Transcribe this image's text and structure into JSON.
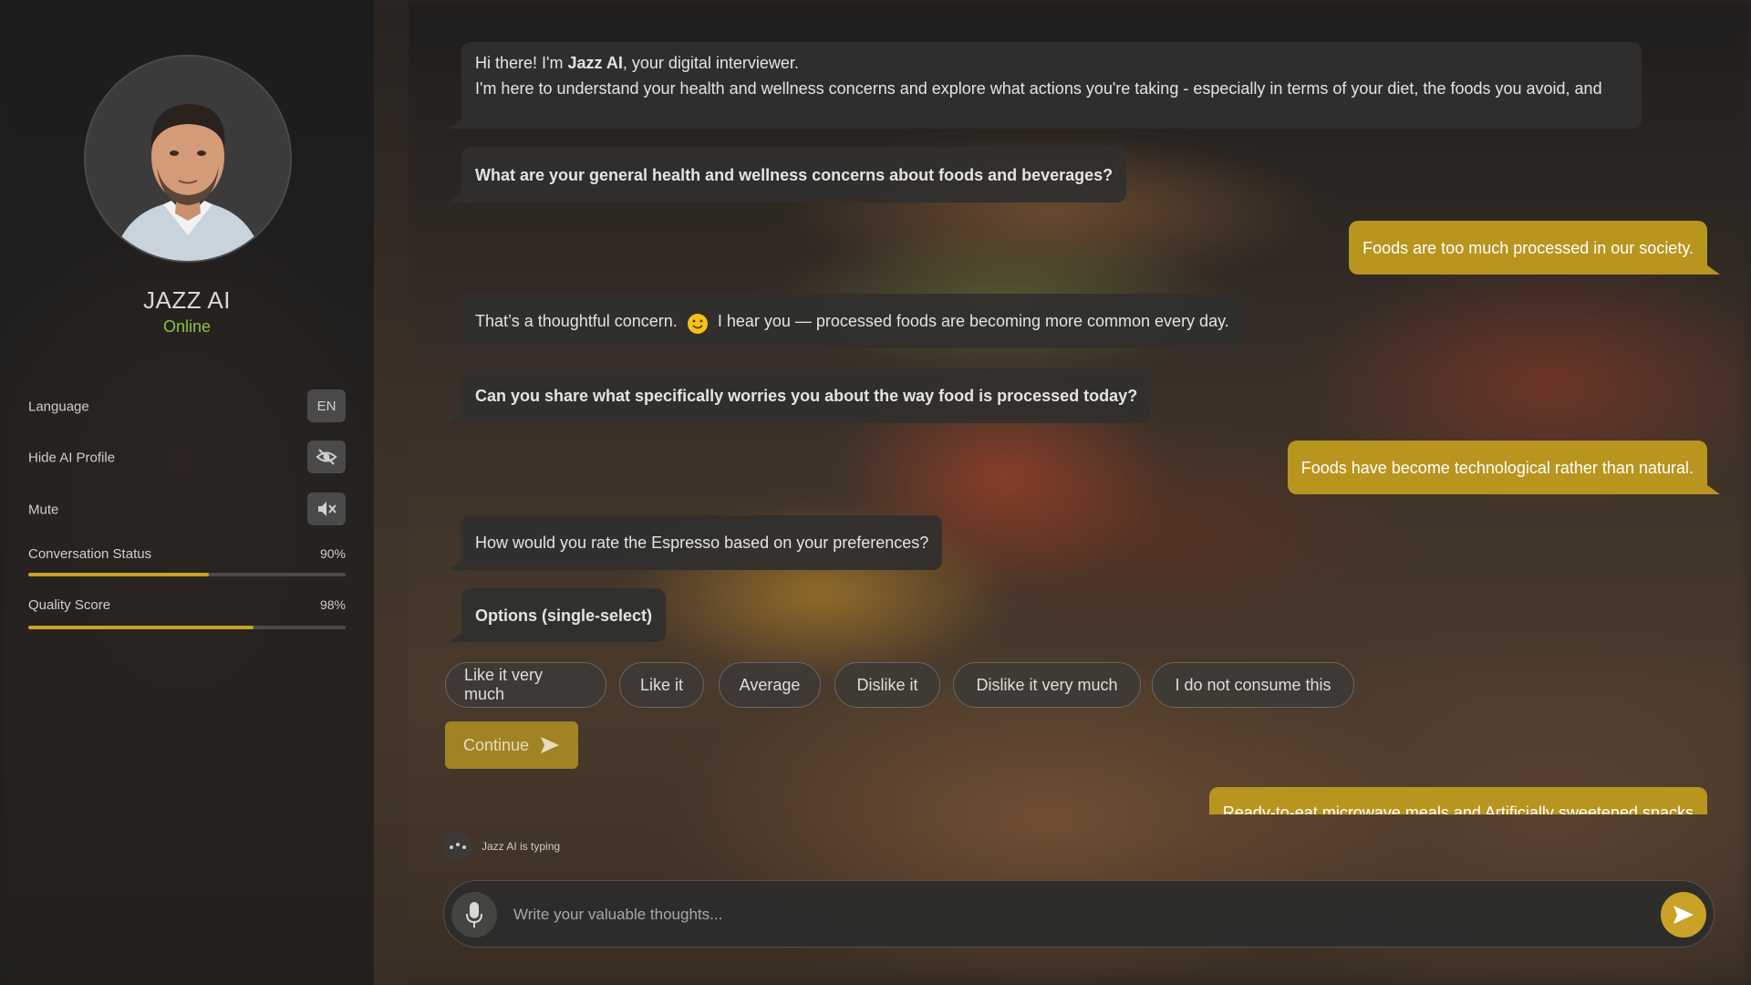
{
  "agent": {
    "name": "JAZZ AI",
    "status": "Online"
  },
  "settings": {
    "language_label": "Language",
    "language_value": "EN",
    "hide_profile_label": "Hide AI Profile",
    "mute_label": "Mute"
  },
  "progress": {
    "conversation_label": "Conversation Status",
    "conversation_value": "90%",
    "conversation_fill": 0.57,
    "quality_label": "Quality Score",
    "quality_value": "98%",
    "quality_fill": 0.71
  },
  "messages": {
    "intro_pre": "Hi there! I'm ",
    "intro_bold": "Jazz AI",
    "intro_post": ", your digital interviewer.",
    "intro_line2": "I'm here to understand your health and wellness concerns and explore what actions you're taking - especially in terms of your diet, the foods you avoid, and",
    "q1": "What are your general health and wellness concerns about foods and beverages?",
    "a1": "Foods are too much processed in our society.",
    "ack_pre": "That’s a thoughtful concern.",
    "ack_post": "I hear you — processed foods are becoming more common every day.",
    "q2": "Can you share what specifically worries you about the way food is processed today?",
    "a2": "Foods have become technological rather than natural.",
    "q3": "How would you rate the Espresso based on your preferences?",
    "options_title": "Options (single-select)",
    "a3_partial": "Ready-to-eat microwave meals and Artificially sweetened snacks"
  },
  "options": [
    "Like it very much",
    "Like it",
    "Average",
    "Dislike it",
    "Dislike it very much",
    "I do not consume this"
  ],
  "continue_label": "Continue",
  "typing_text": "Jazz AI is typing",
  "composer": {
    "placeholder": "Write your valuable thoughts..."
  },
  "colors": {
    "accent": "#c9a227",
    "user_bubble": "#b8951f",
    "online": "#8bc34a"
  }
}
